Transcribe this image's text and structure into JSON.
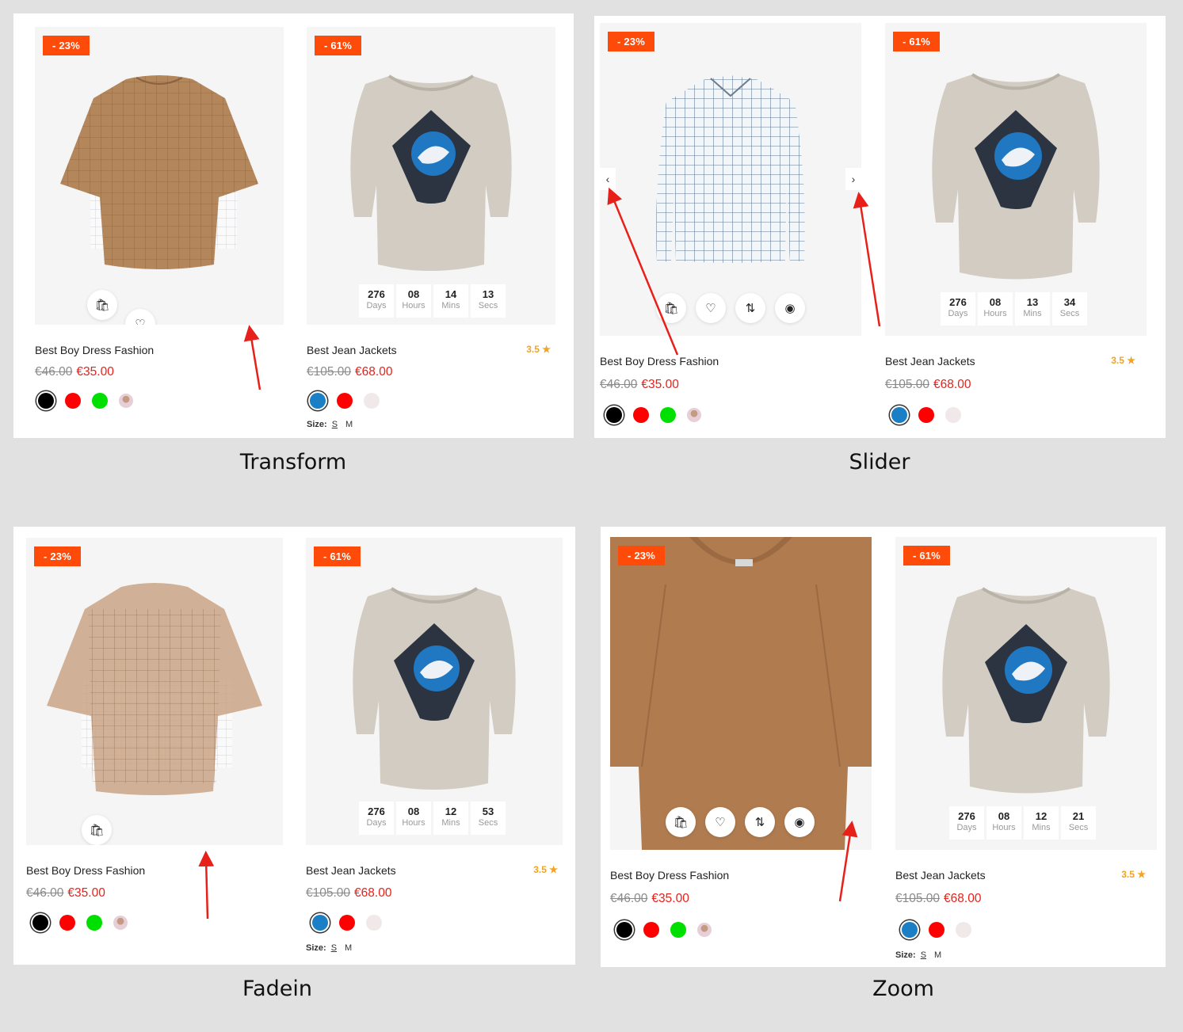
{
  "captions": {
    "transform": "Transform",
    "slider": "Slider",
    "fadein": "Fadein",
    "zoom": "Zoom"
  },
  "product_a": {
    "badge": "- 23%",
    "title": "Best Boy Dress Fashion",
    "old_price": "€46.00",
    "new_price": "€35.00",
    "swatch_colors": [
      "#000000",
      "#ff0000",
      "#00e000"
    ]
  },
  "product_b": {
    "badge": "- 61%",
    "title": "Best Jean Jackets",
    "rating": "3.5 ★",
    "old_price": "€105.00",
    "new_price": "€68.00",
    "swatch_colors": [
      "#1a7fc4",
      "#ff0000",
      "#f1e9e9"
    ],
    "size_label": "Size:",
    "sizes": [
      "S",
      "M"
    ]
  },
  "countdowns": {
    "transform": {
      "days": "276",
      "hours": "08",
      "mins": "14",
      "secs": "13"
    },
    "slider": {
      "days": "276",
      "hours": "08",
      "mins": "13",
      "secs": "34"
    },
    "fadein": {
      "days": "276",
      "hours": "08",
      "mins": "12",
      "secs": "53"
    },
    "zoom": {
      "days": "276",
      "hours": "08",
      "mins": "12",
      "secs": "21"
    }
  },
  "countdown_labels": {
    "days": "Days",
    "hours": "Hours",
    "mins": "Mins",
    "secs": "Secs"
  },
  "icons": {
    "cart": "shopping-bag-icon",
    "wishlist": "heart-icon",
    "compare": "compare-arrows-icon",
    "quickview": "eye-icon",
    "prev": "chevron-left-icon",
    "next": "chevron-right-icon"
  },
  "accent_color": "#ff4b0a",
  "price_color": "#e8201a",
  "rating_color": "#f2a322"
}
